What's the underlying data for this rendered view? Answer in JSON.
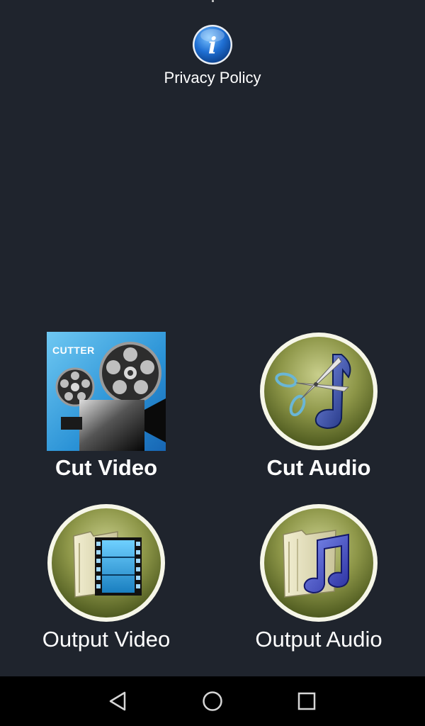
{
  "privacy": {
    "label": "Privacy Policy",
    "icon": "info-icon",
    "icon_letter": "i"
  },
  "tiles": [
    {
      "label": "Cut Video",
      "icon": "film-projector-icon",
      "badge": "CUTTER"
    },
    {
      "label": "Cut Audio",
      "icon": "scissors-music-note-icon"
    },
    {
      "label": "Output Video",
      "icon": "folder-film-icon"
    },
    {
      "label": "Output Audio",
      "icon": "folder-music-icon"
    }
  ],
  "navbar": {
    "back": "back-triangle-icon",
    "home": "home-circle-icon",
    "recent": "recent-apps-square-icon"
  },
  "colors": {
    "background": "#1f242d",
    "text": "#ffffff",
    "navbar": "#000000",
    "badge_olive": "#7d8a3c",
    "info_blue": "#1e6fd1"
  }
}
